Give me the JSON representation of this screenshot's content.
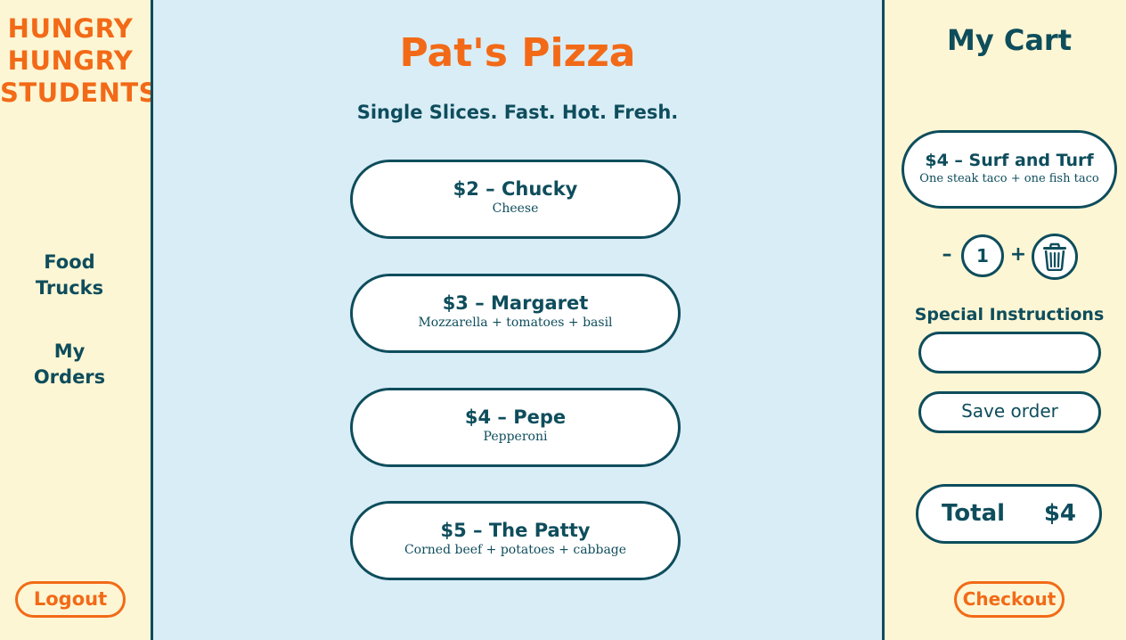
{
  "brand": {
    "lines": [
      "HUNGRY",
      "HUNGRY",
      "STUDENTS"
    ],
    "color": "#f26a17"
  },
  "sidebar": {
    "nav": [
      {
        "lines": [
          "Food",
          "Trucks"
        ]
      },
      {
        "lines": [
          "My",
          "Orders"
        ]
      }
    ],
    "logout_label": "Logout"
  },
  "main": {
    "title": "Pat's Pizza",
    "tagline": "Single Slices. Fast. Hot. Fresh.",
    "menu": [
      {
        "name": "$2 – Chucky",
        "desc": "Cheese"
      },
      {
        "name": "$3 – Margaret",
        "desc": "Mozzarella + tomatoes + basil"
      },
      {
        "name": "$4 – Pepe",
        "desc": "Pepperoni"
      },
      {
        "name": "$5 – The Patty",
        "desc": "Corned beef + potatoes + cabbage"
      }
    ]
  },
  "cart": {
    "title": "My Cart",
    "item": {
      "name": "$4 – Surf and Turf",
      "desc": "One steak taco + one fish taco"
    },
    "quantity": {
      "minus": "–",
      "value": "1",
      "plus": "+"
    },
    "trash_icon": "trash-icon",
    "special_label": "Special Instructions",
    "special_value": "",
    "special_placeholder": "",
    "save_label": "Save order",
    "total_label": "Total",
    "total_value": "$4",
    "checkout_label": "Checkout"
  },
  "colors": {
    "accent": "#f26a17",
    "text": "#0e4d5c",
    "main_bg": "#d9edf6",
    "side_bg": "#fdf6d4"
  }
}
